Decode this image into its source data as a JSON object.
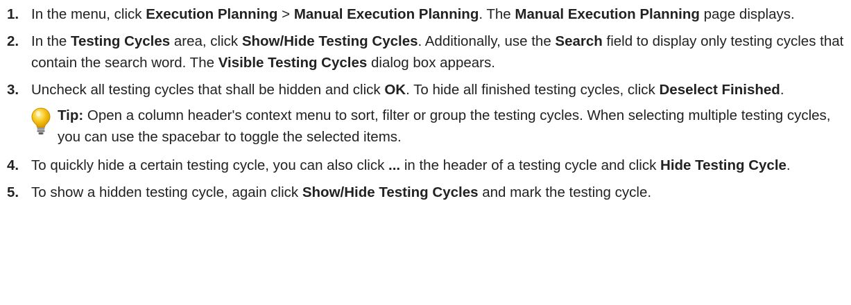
{
  "steps": [
    {
      "number": "1.",
      "segments": [
        {
          "t": "In the menu, click "
        },
        {
          "t": "Execution Planning",
          "b": true
        },
        {
          "t": " > "
        },
        {
          "t": "Manual Execution Planning",
          "b": true
        },
        {
          "t": ". The "
        },
        {
          "t": "Manual Execution Planning",
          "b": true
        },
        {
          "t": " page displays."
        }
      ]
    },
    {
      "number": "2.",
      "segments": [
        {
          "t": "In the "
        },
        {
          "t": "Testing Cycles",
          "b": true
        },
        {
          "t": " area, click "
        },
        {
          "t": "Show/Hide Testing Cycles",
          "b": true
        },
        {
          "t": ". Additionally, use the "
        },
        {
          "t": "Search",
          "b": true
        },
        {
          "t": " field to display only testing cycles that contain the search word. The "
        },
        {
          "t": "Visible Testing Cycles",
          "b": true
        },
        {
          "t": " dialog box appears."
        }
      ]
    },
    {
      "number": "3.",
      "segments": [
        {
          "t": "Uncheck all testing cycles that shall be hidden and click "
        },
        {
          "t": "OK",
          "b": true
        },
        {
          "t": ". To hide all finished testing cycles, click "
        },
        {
          "t": "Deselect Finished",
          "b": true
        },
        {
          "t": "."
        }
      ]
    },
    {
      "number": "4.",
      "segments": [
        {
          "t": "To quickly hide a certain testing cycle, you can also click "
        },
        {
          "t": "...",
          "b": true
        },
        {
          "t": " in the header of a testing cycle and click "
        },
        {
          "t": "Hide Testing Cycle",
          "b": true
        },
        {
          "t": "."
        }
      ]
    },
    {
      "number": "5.",
      "segments": [
        {
          "t": "To show a hidden testing cycle, again click "
        },
        {
          "t": "Show/Hide Testing Cycles",
          "b": true
        },
        {
          "t": " and mark the testing cycle."
        }
      ]
    }
  ],
  "tip": {
    "after_step": 3,
    "icon": "lightbulb-icon",
    "icon_color": "#f5c518",
    "label": "Tip:",
    "text": " Open a column header's context menu to sort, filter or group the testing cycles. When selecting multiple testing cycles, you can use the spacebar to toggle the selected items."
  }
}
